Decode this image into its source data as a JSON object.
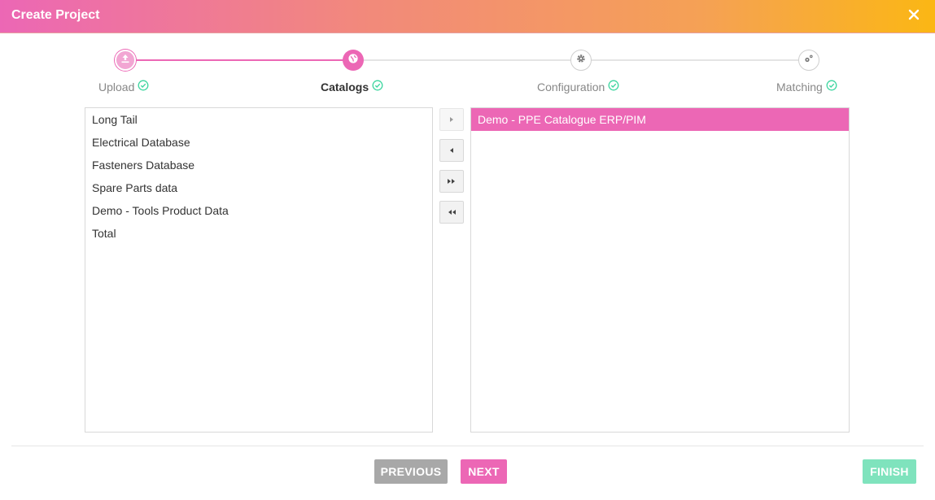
{
  "header": {
    "title": "Create Project",
    "close_icon": "close-icon"
  },
  "stepper": {
    "steps": [
      {
        "label": "Upload",
        "state": "done",
        "icon": "upload-icon"
      },
      {
        "label": "Catalogs",
        "state": "active",
        "icon": "globe-icon"
      },
      {
        "label": "Configuration",
        "state": "pending",
        "icon": "gear-icon"
      },
      {
        "label": "Matching",
        "state": "pending",
        "icon": "gears-icon"
      }
    ],
    "check_color": "#3ed6a0"
  },
  "available_catalogs": [
    "Long Tail",
    "Electrical Database",
    "Fasteners Database",
    "Spare Parts data",
    "Demo - Tools Product Data",
    "Total"
  ],
  "selected_catalogs": [
    "Demo - PPE Catalogue ERP/PIM"
  ],
  "buttons": {
    "previous": "PREVIOUS",
    "next": "NEXT",
    "finish": "FINISH"
  },
  "colors": {
    "accent": "#ec67b5",
    "finish": "#7fe3bd",
    "previous": "#a8a8a8"
  }
}
